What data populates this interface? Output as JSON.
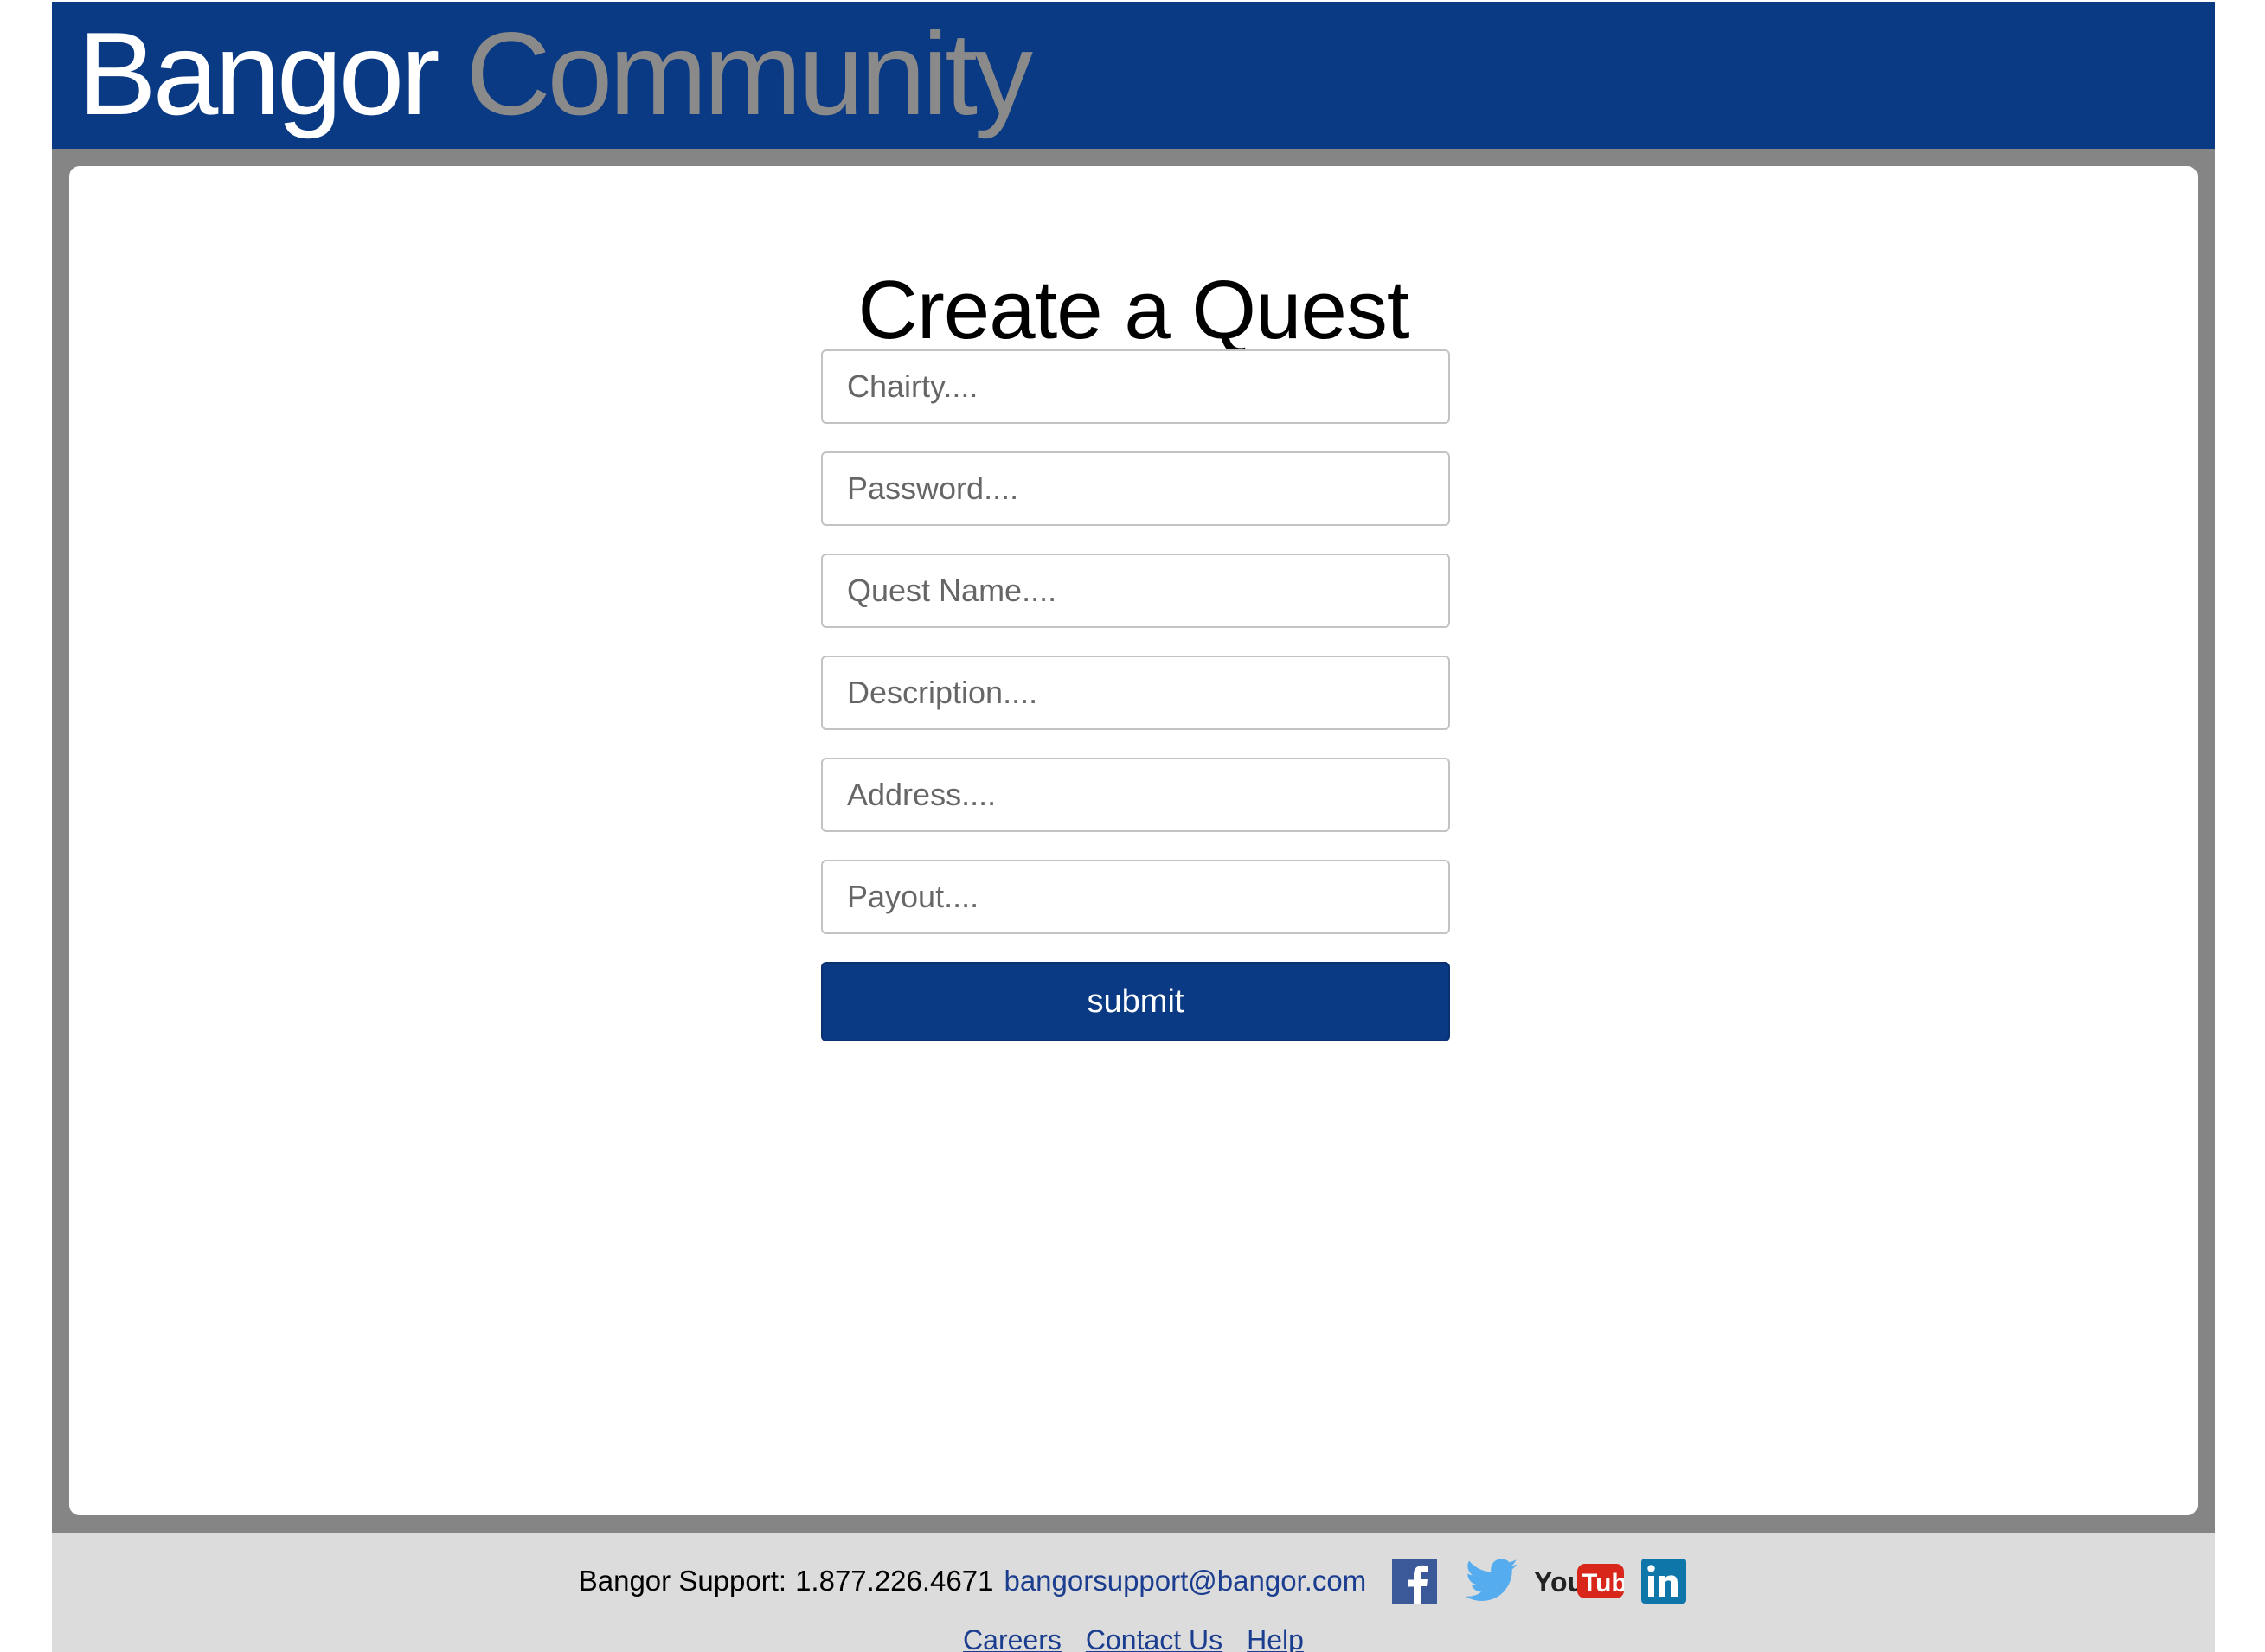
{
  "header": {
    "brand_primary": "Bangor",
    "brand_secondary": "Community",
    "colors": {
      "bar": "#0b3a84",
      "secondary_text": "#8a8a8a"
    }
  },
  "main": {
    "title": "Create a Quest",
    "fields": [
      {
        "name": "charity",
        "placeholder": "Chairty...."
      },
      {
        "name": "password",
        "placeholder": "Password...."
      },
      {
        "name": "quest_name",
        "placeholder": "Quest Name...."
      },
      {
        "name": "description",
        "placeholder": "Description...."
      },
      {
        "name": "address",
        "placeholder": "Address...."
      },
      {
        "name": "payout",
        "placeholder": "Payout...."
      }
    ],
    "submit_label": "submit"
  },
  "footer": {
    "support_label": "Bangor Support:",
    "support_phone": "1.877.226.4671",
    "support_email": "bangorsupport@bangor.com",
    "social_icons": [
      "facebook-icon",
      "twitter-icon",
      "youtube-icon",
      "linkedin-icon"
    ],
    "links": [
      "Careers",
      "Contact Us",
      "Help"
    ]
  }
}
